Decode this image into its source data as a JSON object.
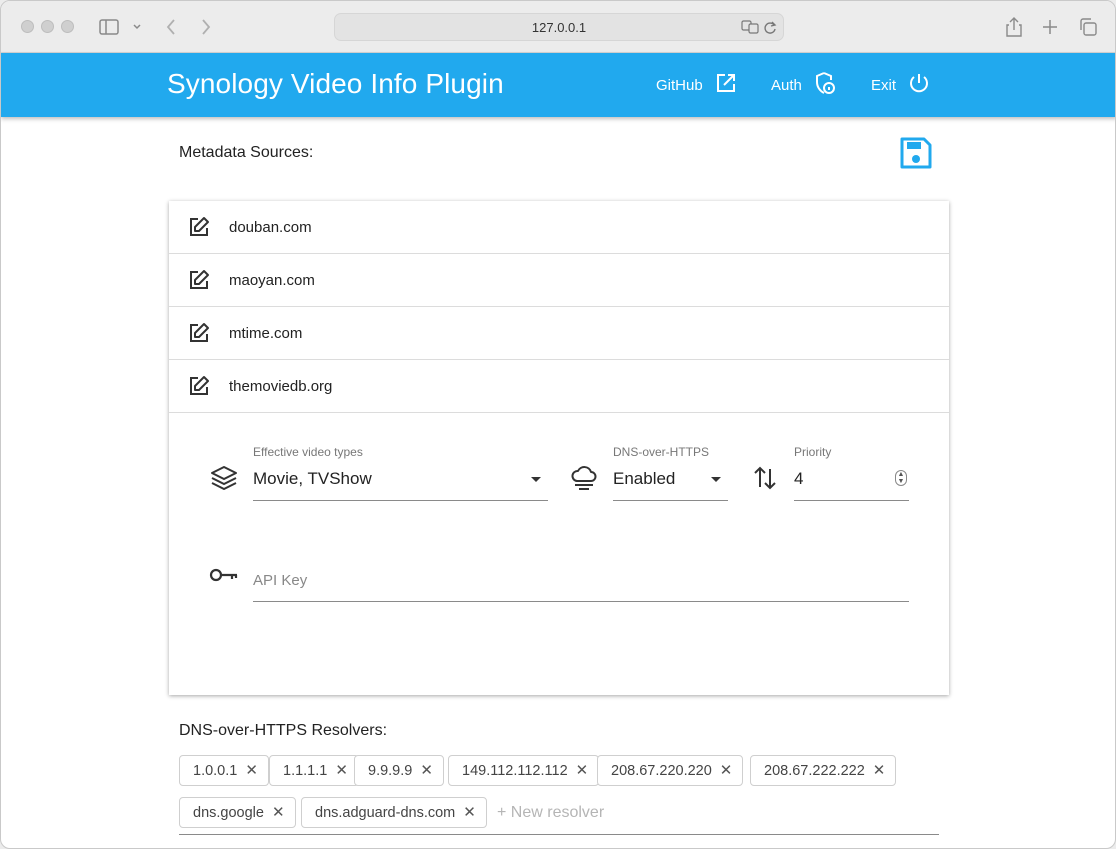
{
  "browser": {
    "url": "127.0.0.1"
  },
  "appbar": {
    "title": "Synology Video Info Plugin",
    "github_label": "GitHub",
    "auth_label": "Auth",
    "exit_label": "Exit"
  },
  "metadata": {
    "heading": "Metadata Sources:",
    "sources": [
      "douban.com",
      "maoyan.com",
      "mtime.com",
      "themoviedb.org"
    ],
    "video_types_label": "Effective video types",
    "video_types_value": "Movie, TVShow",
    "doh_label": "DNS-over-HTTPS",
    "doh_value": "Enabled",
    "priority_label": "Priority",
    "priority_value": "4",
    "api_key_placeholder": "API Key"
  },
  "resolvers": {
    "heading": "DNS-over-HTTPS Resolvers:",
    "items": [
      "1.0.0.1",
      "1.1.1.1",
      "9.9.9.9",
      "149.112.112.112",
      "208.67.220.220",
      "208.67.222.222",
      "dns.google",
      "dns.adguard-dns.com"
    ],
    "new_placeholder": "+ New resolver"
  },
  "colors": {
    "accent": "#21a9ee"
  }
}
